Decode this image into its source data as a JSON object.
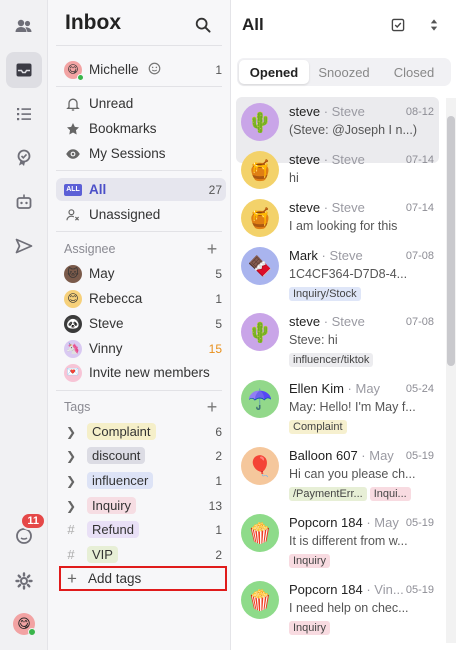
{
  "sidebar": {
    "title": "Inbox",
    "profile": {
      "name": "Michelle",
      "count": "1"
    },
    "views": [
      {
        "label": "Unread",
        "icon": "bell-icon"
      },
      {
        "label": "Bookmarks",
        "icon": "star-icon"
      },
      {
        "label": "My Sessions",
        "icon": "eye-icon"
      }
    ],
    "all": {
      "label": "All",
      "count": "27"
    },
    "unassigned": {
      "label": "Unassigned"
    },
    "assignee_title": "Assignee",
    "assignees": [
      {
        "name": "May",
        "count": "5",
        "highlight": false
      },
      {
        "name": "Rebecca",
        "count": "1",
        "highlight": false
      },
      {
        "name": "Steve",
        "count": "5",
        "highlight": false
      },
      {
        "name": "Vinny",
        "count": "15",
        "highlight": true
      }
    ],
    "invite_label": "Invite new members",
    "tags_title": "Tags",
    "tags": [
      {
        "label": "Complaint",
        "count": "6",
        "color": "#f5efc9",
        "expandable": true
      },
      {
        "label": "discount",
        "count": "2",
        "color": "#dcdce4",
        "expandable": true
      },
      {
        "label": "influencer",
        "count": "1",
        "color": "#dde3f6",
        "expandable": true
      },
      {
        "label": "Inquiry",
        "count": "13",
        "color": "#f6dde3",
        "expandable": true
      },
      {
        "label": "Refund",
        "count": "1",
        "color": "#e9e0f6",
        "expandable": false
      },
      {
        "label": "VIP",
        "count": "2",
        "color": "#e7efd6",
        "expandable": false
      }
    ],
    "add_tags_label": "Add tags"
  },
  "rail": {
    "badge_count": "11"
  },
  "list": {
    "title": "All",
    "tabs": [
      {
        "label": "Opened",
        "active": true
      },
      {
        "label": "Snoozed",
        "active": false
      },
      {
        "label": "Closed",
        "active": false
      }
    ],
    "conversations": [
      {
        "name": "steve",
        "source": "Steve",
        "date": "08-12",
        "preview": "(Steve: @Joseph I n...)",
        "avatar": "🌵",
        "avatar_bg": "#c9a5e8",
        "tags": [],
        "active": true
      },
      {
        "name": "steve",
        "source": "Steve",
        "date": "07-14",
        "preview": "hi",
        "avatar": "🍯",
        "avatar_bg": "#f3d26a",
        "tags": [],
        "active": false
      },
      {
        "name": "steve",
        "source": "Steve",
        "date": "07-14",
        "preview": "I am looking for this",
        "avatar": "🍯",
        "avatar_bg": "#f3d26a",
        "tags": [],
        "active": false
      },
      {
        "name": "Mark",
        "source": "Steve",
        "date": "07-08",
        "preview": "1C4CF364-D7D8-4...",
        "avatar": "🍫",
        "avatar_bg": "#a9b4ee",
        "tags": [
          {
            "label": "Inquiry/Stock",
            "color": "#dfe6f8"
          }
        ],
        "active": false
      },
      {
        "name": "steve",
        "source": "Steve",
        "date": "07-08",
        "preview": "Steve: hi",
        "avatar": "🌵",
        "avatar_bg": "#c9a5e8",
        "tags": [
          {
            "label": "influencer/tiktok",
            "color": "#ececef"
          }
        ],
        "active": false
      },
      {
        "name": "Ellen Kim",
        "source": "May",
        "date": "05-24",
        "preview": "May: Hello! I'm May f...",
        "avatar": "☂️",
        "avatar_bg": "#92d88a",
        "tags": [
          {
            "label": "Complaint",
            "color": "#f6f0cf"
          }
        ],
        "active": false
      },
      {
        "name": "Balloon 607",
        "source": "May",
        "date": "05-19",
        "preview": "Hi can you please ch...",
        "avatar": "🎈",
        "avatar_bg": "#f5c79c",
        "tags": [
          {
            "label": "/PaymentErr...",
            "color": "#e7efd6"
          },
          {
            "label": "Inqui...",
            "color": "#f8dbe1"
          }
        ],
        "active": false
      },
      {
        "name": "Popcorn 184",
        "source": "May",
        "date": "05-19",
        "preview": "It is different from w...",
        "avatar": "🍿",
        "avatar_bg": "#8edb8a",
        "tags": [
          {
            "label": "Inquiry",
            "color": "#f8dbe1"
          }
        ],
        "active": false
      },
      {
        "name": "Popcorn 184",
        "source": "Vin...",
        "date": "05-19",
        "preview": "I need help on chec...",
        "avatar": "🍿",
        "avatar_bg": "#8edb8a",
        "tags": [
          {
            "label": "Inquiry",
            "color": "#f8dbe1"
          }
        ],
        "active": false
      }
    ]
  }
}
